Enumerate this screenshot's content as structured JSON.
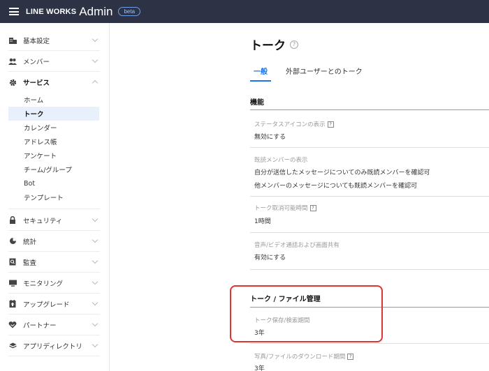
{
  "header": {
    "logo": "LINE WORKS",
    "admin": "Admin",
    "badge": "beta"
  },
  "sidebar": {
    "items": [
      {
        "label": "基本設定",
        "icon": "building-icon"
      },
      {
        "label": "メンバー",
        "icon": "members-icon"
      },
      {
        "label": "サービス",
        "icon": "gear-icon"
      },
      {
        "label": "セキュリティ",
        "icon": "lock-icon"
      },
      {
        "label": "統計",
        "icon": "pie-chart-icon"
      },
      {
        "label": "監査",
        "icon": "search-document-icon"
      },
      {
        "label": "モニタリング",
        "icon": "monitor-icon"
      },
      {
        "label": "アップグレード",
        "icon": "upgrade-icon"
      },
      {
        "label": "パートナー",
        "icon": "handshake-icon"
      },
      {
        "label": "アプリディレクトリ",
        "icon": "layers-icon"
      }
    ],
    "service_sub": [
      "ホーム",
      "トーク",
      "カレンダー",
      "アドレス帳",
      "アンケート",
      "チーム/グループ",
      "Bot",
      "テンプレート"
    ]
  },
  "main": {
    "title": "トーク",
    "help": "?",
    "tabs": [
      "一般",
      "外部ユーザーとのトーク"
    ],
    "section1": "機能",
    "settings": [
      {
        "label": "ステータスアイコンの表示",
        "values": [
          "無効にする"
        ]
      },
      {
        "label": "既読メンバーの表示",
        "values": [
          "自分が送信したメッセージについてのみ既読メンバーを確認可",
          "他メンバーのメッセージについても既読メンバーを確認可"
        ]
      },
      {
        "label": "トーク取消可能時間",
        "values": [
          "1時間"
        ]
      },
      {
        "label": "音声/ビデオ通話および画面共有",
        "values": [
          "有効にする"
        ]
      }
    ],
    "section2": "トーク / ファイル管理",
    "settings2": [
      {
        "label": "トーク保存/検索期間",
        "values": [
          "3年"
        ]
      },
      {
        "label": "写真/ファイルのダウンロード期間",
        "values": [
          "3年"
        ]
      }
    ],
    "q": "?"
  },
  "colors": {
    "topbar": "#2e3245",
    "accent": "#1a73e8",
    "highlight": "#e03333"
  }
}
